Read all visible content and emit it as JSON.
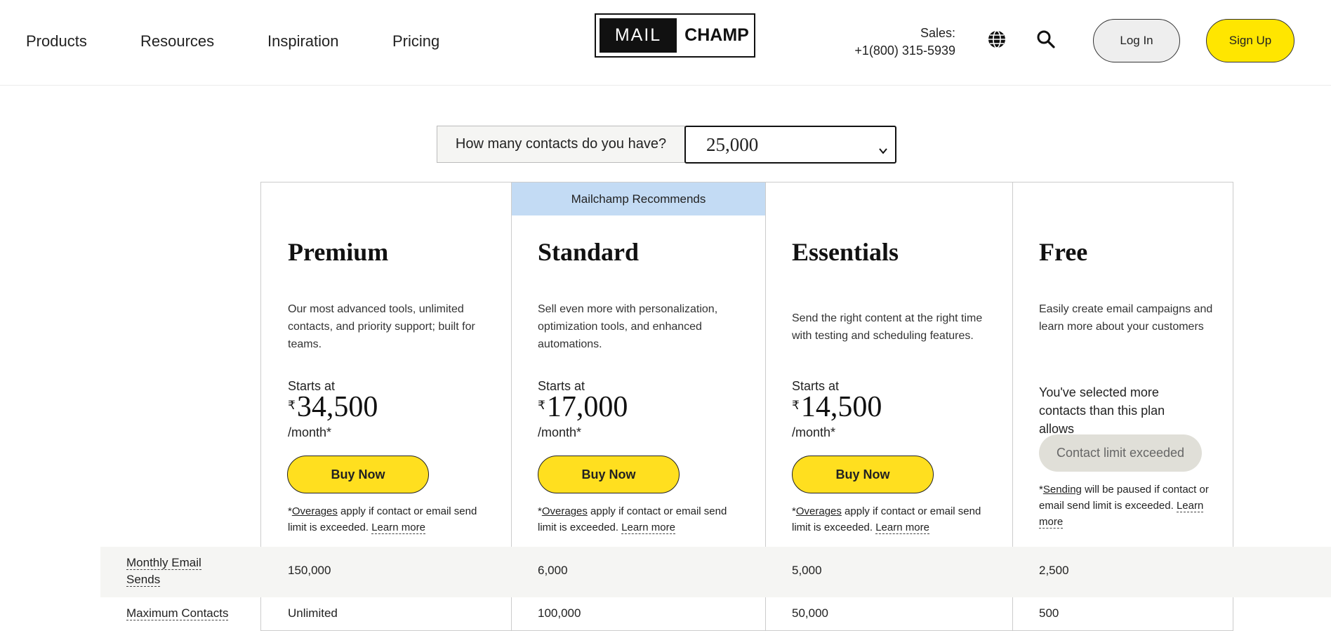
{
  "nav": {
    "items": [
      "Products",
      "Resources",
      "Inspiration",
      "Pricing"
    ]
  },
  "logo": {
    "left": "MAIL",
    "right": "CHAMP"
  },
  "sales": {
    "label": "Sales:",
    "phone": "+1(800) 315-5939"
  },
  "header_buttons": {
    "login": "Log In",
    "signup": "Sign Up"
  },
  "icons": [
    "globe-icon",
    "search-icon",
    "chevron-down-icon"
  ],
  "colors": {
    "accent_yellow": "#ffdf1f",
    "signup_yellow": "#ffe600",
    "recommend_blue": "#c3dbf4",
    "band_gray": "#f5f5f3"
  },
  "contacts": {
    "question": "How many contacts do you have?",
    "selected": "25,000"
  },
  "recommend_banner": "Mailchamp Recommends",
  "plans": [
    {
      "name": "Premium",
      "description": "Our most advanced tools, unlimited contacts, and priority support; built for teams.",
      "starts_at": "Starts at",
      "currency": "₹",
      "price": "34,500",
      "per": "/month*",
      "buy": "Buy Now",
      "fine_star": "*",
      "fine_link": "Overages",
      "fine_text": " apply if contact or email send limit is exceeded. ",
      "fine_learn": "Learn more"
    },
    {
      "name": "Standard",
      "description": "Sell even more with personalization, optimization tools, and enhanced automations.",
      "starts_at": "Starts at",
      "currency": "₹",
      "price": "17,000",
      "per": "/month*",
      "buy": "Buy Now",
      "fine_star": "*",
      "fine_link": "Overages",
      "fine_text": " apply if contact or email send limit is exceeded. ",
      "fine_learn": "Learn more"
    },
    {
      "name": "Essentials",
      "description": "Send the right content at the right time with testing and scheduling features.",
      "starts_at": "Starts at",
      "currency": "₹",
      "price": "14,500",
      "per": "/month*",
      "buy": "Buy Now",
      "fine_star": "*",
      "fine_link": "Overages",
      "fine_text": " apply if contact or email send limit is exceeded. ",
      "fine_learn": "Learn more"
    },
    {
      "name": "Free",
      "description": "Easily create email campaigns and learn more about your customers",
      "warning": "You've selected more contacts than this plan allows",
      "limit_button": "Contact limit exceeded",
      "fine_star": "*",
      "fine_link": "Sending",
      "fine_text": " will be paused if contact or email send limit is exceeded. ",
      "fine_learn": "Learn more"
    }
  ],
  "table": {
    "rows": [
      {
        "label": "Monthly Email Sends",
        "values": [
          "150,000",
          "6,000",
          "5,000",
          "2,500"
        ]
      },
      {
        "label": "Maximum Contacts",
        "values": [
          "Unlimited",
          "100,000",
          "50,000",
          "500"
        ]
      }
    ]
  }
}
